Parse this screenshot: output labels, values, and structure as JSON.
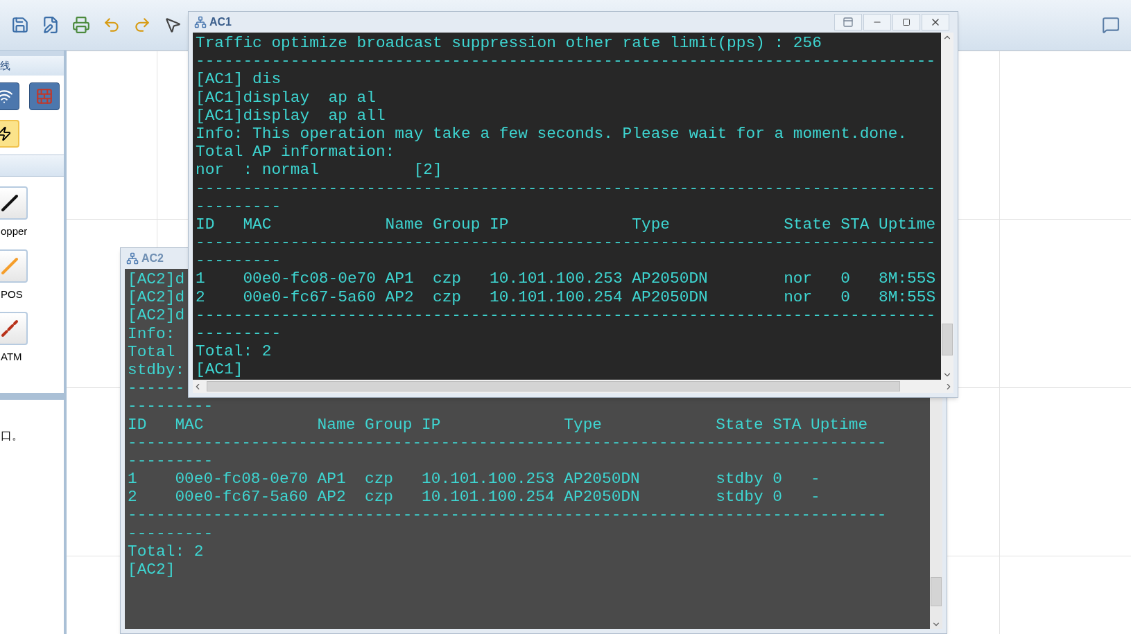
{
  "sidebar": {
    "header": "线",
    "tools": [
      {
        "kind": "wireless",
        "selected": false
      },
      {
        "kind": "firewall",
        "selected": false
      },
      {
        "kind": "auto-link",
        "selected": true
      }
    ],
    "links": [
      {
        "kind": "copper",
        "label": "opper"
      },
      {
        "kind": "pos",
        "label": "POS"
      },
      {
        "kind": "atm",
        "label": "ATM"
      }
    ],
    "note": "口。"
  },
  "windows": [
    {
      "title": "AC2",
      "active": false,
      "lines": [
        "[AC2]d",
        "[AC2]d",
        "[AC2]d",
        "Info:",
        "Total",
        "stdby:",
        "------",
        "---------",
        "ID   MAC            Name Group IP             Type            State STA Uptime",
        "--------------------------------------------------------------------------------",
        "---------",
        "1    00e0-fc08-0e70 AP1  czp   10.101.100.253 AP2050DN        stdby 0   -",
        "2    00e0-fc67-5a60 AP2  czp   10.101.100.254 AP2050DN        stdby 0   -",
        "--------------------------------------------------------------------------------",
        "---------",
        "Total: 2",
        "[AC2]"
      ]
    },
    {
      "title": "AC1",
      "active": true,
      "lines": [
        "Traffic optimize broadcast suppression other rate limit(pps) : 256",
        "------------------------------------------------------------------------------",
        "[AC1] dis",
        "[AC1]display  ap al",
        "[AC1]display  ap all",
        "Info: This operation may take a few seconds. Please wait for a moment.done.",
        "Total AP information:",
        "nor  : normal          [2]",
        "------------------------------------------------------------------------------",
        "---------",
        "ID   MAC            Name Group IP             Type            State STA Uptime",
        "------------------------------------------------------------------------------",
        "---------",
        "1    00e0-fc08-0e70 AP1  czp   10.101.100.253 AP2050DN        nor   0   8M:55S",
        "2    00e0-fc67-5a60 AP2  czp   10.101.100.254 AP2050DN        nor   0   8M:55S",
        "------------------------------------------------------------------------------",
        "---------",
        "Total: 2",
        "[AC1]"
      ]
    }
  ]
}
